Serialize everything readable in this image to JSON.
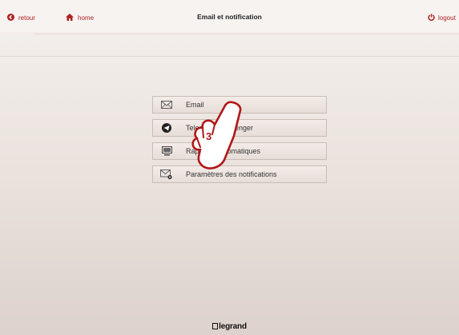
{
  "header": {
    "back_label": "retour",
    "home_label": "home",
    "title": "Email et notification",
    "logout_label": "logout"
  },
  "menu": {
    "items": [
      {
        "label": "Email",
        "icon": "envelope-icon"
      },
      {
        "label": "Telegram Messenger",
        "icon": "telegram-icon"
      },
      {
        "label": "Rapports automatiques",
        "icon": "monitor-report-icon"
      },
      {
        "label": "Paramètres des notifications",
        "icon": "envelope-gear-icon"
      }
    ]
  },
  "annotation": {
    "step_number": "3"
  },
  "footer": {
    "brand": "legrand"
  },
  "colors": {
    "accent": "#b02020",
    "button_border": "#c9bdb6",
    "background": "#ece4df"
  }
}
